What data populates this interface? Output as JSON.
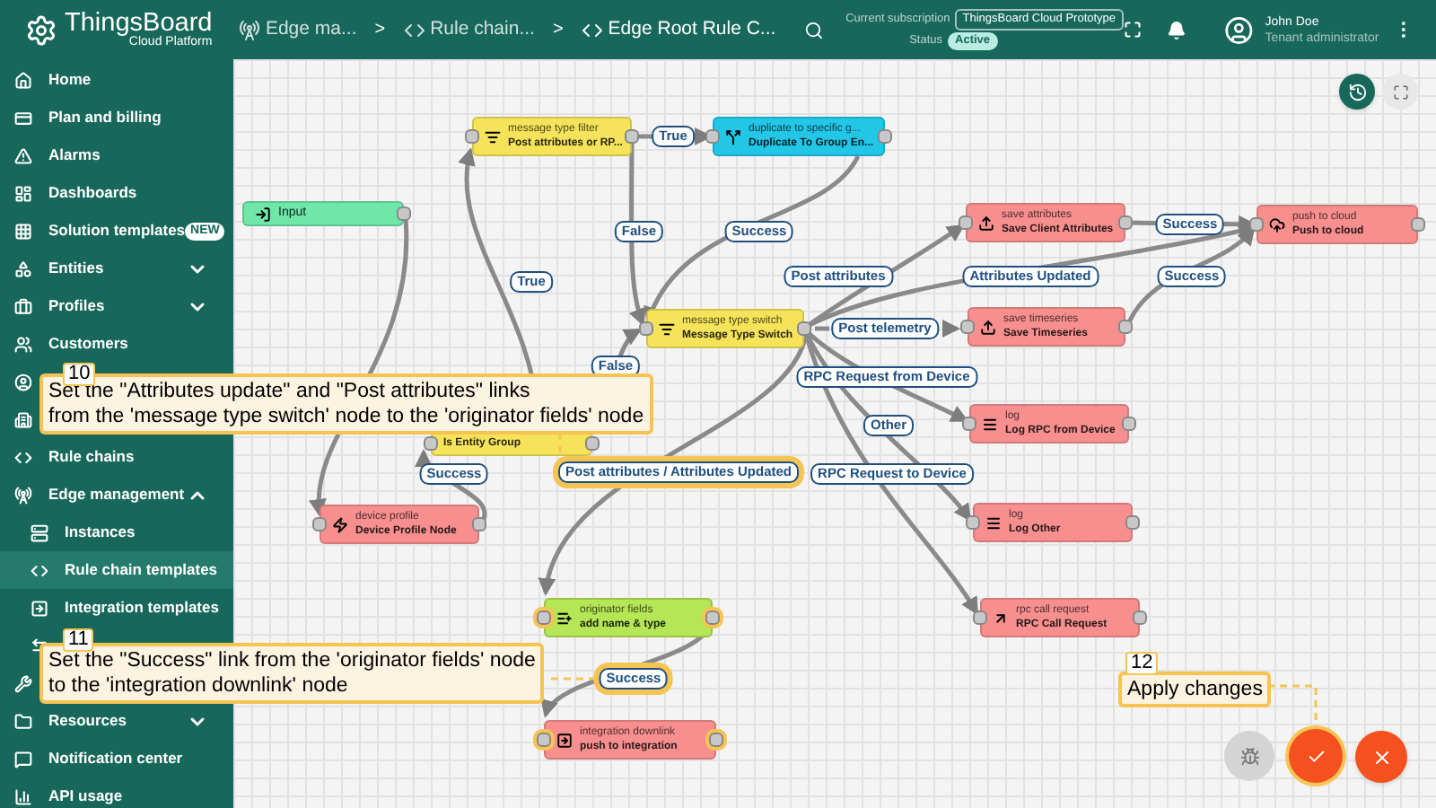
{
  "header": {
    "logo": {
      "title": "ThingsBoard",
      "subtitle": "Cloud Platform"
    },
    "breadcrumbs": [
      {
        "label": "Edge ma..."
      },
      {
        "label": "Rule chain..."
      },
      {
        "label": "Edge Root Rule C..."
      }
    ],
    "breadcrumb_separators": [
      ">",
      ">"
    ],
    "subscription": {
      "label": "Current subscription",
      "plan": "ThingsBoard Cloud Prototype",
      "status_label": "Status",
      "status": "Active"
    },
    "user": {
      "name": "John Doe",
      "role": "Tenant administrator"
    }
  },
  "sidebar": {
    "items": [
      {
        "label": "Home",
        "selected": false
      },
      {
        "label": "Plan and billing",
        "selected": false
      },
      {
        "label": "Alarms",
        "selected": false
      },
      {
        "label": "Dashboards",
        "selected": false
      },
      {
        "label": "Solution templates",
        "selected": false,
        "badge": "NEW"
      },
      {
        "label": "Entities",
        "selected": false,
        "expanded": false
      },
      {
        "label": "Profiles",
        "selected": false,
        "expanded": false
      },
      {
        "label": "Customers",
        "selected": false
      },
      {
        "selected": false
      },
      {
        "selected": false
      },
      {
        "label": "Rule chains",
        "selected": false
      },
      {
        "label": "Edge management",
        "selected": false,
        "expanded": true,
        "children": [
          {
            "label": "Instances",
            "selected": false
          },
          {
            "label": "Rule chain templates",
            "selected": true
          },
          {
            "label": "Integration templates",
            "selected": false
          },
          {
            "selected": false
          }
        ]
      },
      {
        "selected": false
      },
      {
        "label": "Resources",
        "selected": false,
        "expanded": false
      },
      {
        "label": "Notification center",
        "selected": false
      },
      {
        "label": "API usage",
        "selected": false
      }
    ]
  },
  "canvas": {
    "nodes": [
      {
        "kind": "input",
        "name": "Input",
        "highlighted": false
      },
      {
        "kind": "filter",
        "type": "message type filter",
        "name": "Post attributes or RP...",
        "highlighted": false
      },
      {
        "kind": "flow",
        "type": "duplicate to specific g...",
        "name": "Duplicate To Group En...",
        "highlighted": false
      },
      {
        "kind": "filter",
        "type": "message type switch",
        "name": "Message Type Switch",
        "highlighted": false
      },
      {
        "kind": "action",
        "type": "save attributes",
        "name": "Save Client Attributes",
        "highlighted": false
      },
      {
        "kind": "action",
        "type": "push to cloud",
        "name": "Push to cloud",
        "highlighted": false
      },
      {
        "kind": "action",
        "type": "save timeseries",
        "name": "Save Timeseries",
        "highlighted": false
      },
      {
        "kind": "action",
        "type": "log",
        "name": "Log RPC from Device",
        "highlighted": false
      },
      {
        "kind": "action",
        "type": "log",
        "name": "Log Other",
        "highlighted": false
      },
      {
        "kind": "action",
        "type": "rpc call request",
        "name": "RPC Call Request",
        "highlighted": false
      },
      {
        "kind": "action",
        "type": "device profile",
        "name": "Device Profile Node",
        "highlighted": false
      },
      {
        "kind": "filter",
        "name": "Is Entity Group",
        "highlighted": false
      },
      {
        "kind": "transformation",
        "type": "originator fields",
        "name": "add name & type",
        "highlighted": true
      },
      {
        "kind": "action",
        "type": "integration downlink",
        "name": "push to integration",
        "highlighted": true
      }
    ],
    "links": [
      {
        "label": "True",
        "highlighted": false
      },
      {
        "label": "False",
        "highlighted": false
      },
      {
        "label": "Success",
        "highlighted": false
      },
      {
        "label": "True",
        "highlighted": false
      },
      {
        "label": "False",
        "highlighted": false
      },
      {
        "label": "Success",
        "highlighted": false
      },
      {
        "label": "Post attributes / Attributes Updated",
        "highlighted": true
      },
      {
        "label": "Post attributes",
        "highlighted": false
      },
      {
        "label": "Attributes Updated",
        "highlighted": false
      },
      {
        "label": "Success",
        "highlighted": false
      },
      {
        "label": "Success",
        "highlighted": false
      },
      {
        "label": "Post telemetry",
        "highlighted": false
      },
      {
        "label": "RPC Request from Device",
        "highlighted": false
      },
      {
        "label": "Other",
        "highlighted": false
      },
      {
        "label": "RPC Request to Device",
        "highlighted": false
      },
      {
        "label": "Success",
        "highlighted": true
      }
    ]
  },
  "callouts": [
    {
      "number": "10",
      "text": "Set the \"Attributes update\" and \"Post attributes\" links\nfrom the 'message type switch' node to the 'originator fields' node"
    },
    {
      "number": "11",
      "text": "Set the \"Success\" link from the 'originator fields' node\nto the 'integration downlink' node"
    },
    {
      "number": "12",
      "text": "Apply changes"
    }
  ]
}
